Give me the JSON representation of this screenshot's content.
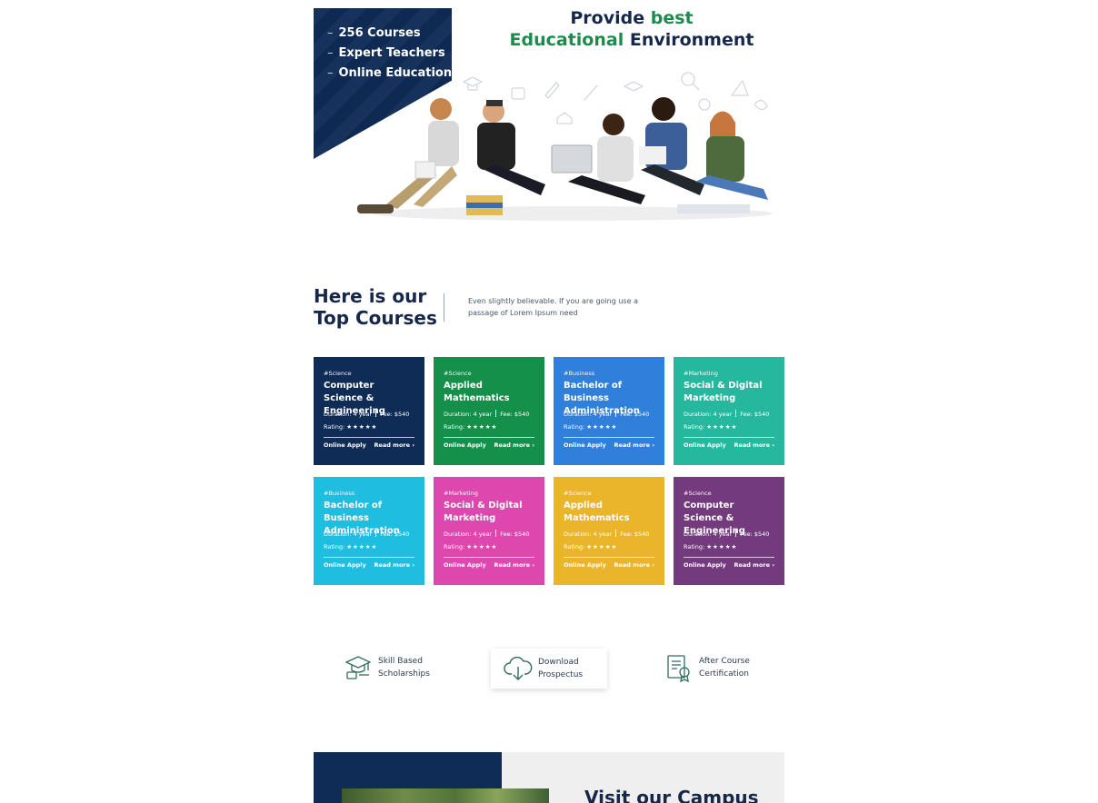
{
  "hero": {
    "bullets": [
      "256 Courses",
      "Expert Teachers",
      "Online Education"
    ],
    "title_part1": "Provide ",
    "title_highlight1": "best",
    "title_highlight2": "Educational",
    "title_part2": " Environment"
  },
  "courses_section": {
    "title_line1": "Here is our",
    "title_line2": "Top Courses",
    "subtitle": "Even slightly believable. If you are going use a passage of Lorem Ipsum need"
  },
  "cards": [
    {
      "tag": "#Science",
      "title": "Computer Science & Engineering",
      "duration": "Duration: 4 year",
      "fee": "Fee: $540",
      "rating_label": "Rating:",
      "stars": "★★★★★",
      "apply": "Online Apply",
      "more": "Read more",
      "color": "#0f2c57"
    },
    {
      "tag": "#Science",
      "title": "Applied Mathematics",
      "duration": "Duration: 4 year",
      "fee": "Fee: $540",
      "rating_label": "Rating:",
      "stars": "★★★★★",
      "apply": "Online Apply",
      "more": "Read more",
      "color": "#14904a"
    },
    {
      "tag": "#Business",
      "title": "Bachelor of Business Administration",
      "duration": "Duration: 4 year",
      "fee": "Fee: $540",
      "rating_label": "Rating:",
      "stars": "★★★★★",
      "apply": "Online Apply",
      "more": "Read more",
      "color": "#2f7fdb"
    },
    {
      "tag": "#Marketing",
      "title": "Social & Digital Marketing",
      "duration": "Duration: 4 year",
      "fee": "Fee: $540",
      "rating_label": "Rating:",
      "stars": "★★★★★",
      "apply": "Online Apply",
      "more": "Read more",
      "color": "#26b89e"
    },
    {
      "tag": "#Business",
      "title": "Bachelor of Business Administration",
      "duration": "Duration: 4 year",
      "fee": "Fee: $540",
      "rating_label": "Rating:",
      "stars": "★★★★★",
      "apply": "Online Apply",
      "more": "Read more",
      "color": "#1fbde0"
    },
    {
      "tag": "#Marketing",
      "title": "Social & Digital Marketing",
      "duration": "Duration: 4 year",
      "fee": "Fee: $540",
      "rating_label": "Rating:",
      "stars": "★★★★★",
      "apply": "Online Apply",
      "more": "Read more",
      "color": "#de47ad"
    },
    {
      "tag": "#Science",
      "title": "Applied Mathematics",
      "duration": "Duration: 4 year",
      "fee": "Fee: $540",
      "rating_label": "Rating:",
      "stars": "★★★★★",
      "apply": "Online Apply",
      "more": "Read more",
      "color": "#ebb52b"
    },
    {
      "tag": "#Science",
      "title": "Computer Science & Engineering",
      "duration": "Duration: 4 year",
      "fee": "Fee: $540",
      "rating_label": "Rating:",
      "stars": "★★★★★",
      "apply": "Online Apply",
      "more": "Read more",
      "color": "#743a7e"
    }
  ],
  "features": [
    {
      "icon": "graduation-cap-icon",
      "line1": "Skill Based",
      "line2": "Scholarships"
    },
    {
      "icon": "cloud-download-icon",
      "line1": "Download",
      "line2": "Prospectus"
    },
    {
      "icon": "certificate-icon",
      "line1": "After Course",
      "line2": "Certification"
    }
  ],
  "campus": {
    "title": "Visit our Campus"
  },
  "colors": {
    "brand_navy": "#0f2c57",
    "accent_green": "#1e8a4e"
  }
}
